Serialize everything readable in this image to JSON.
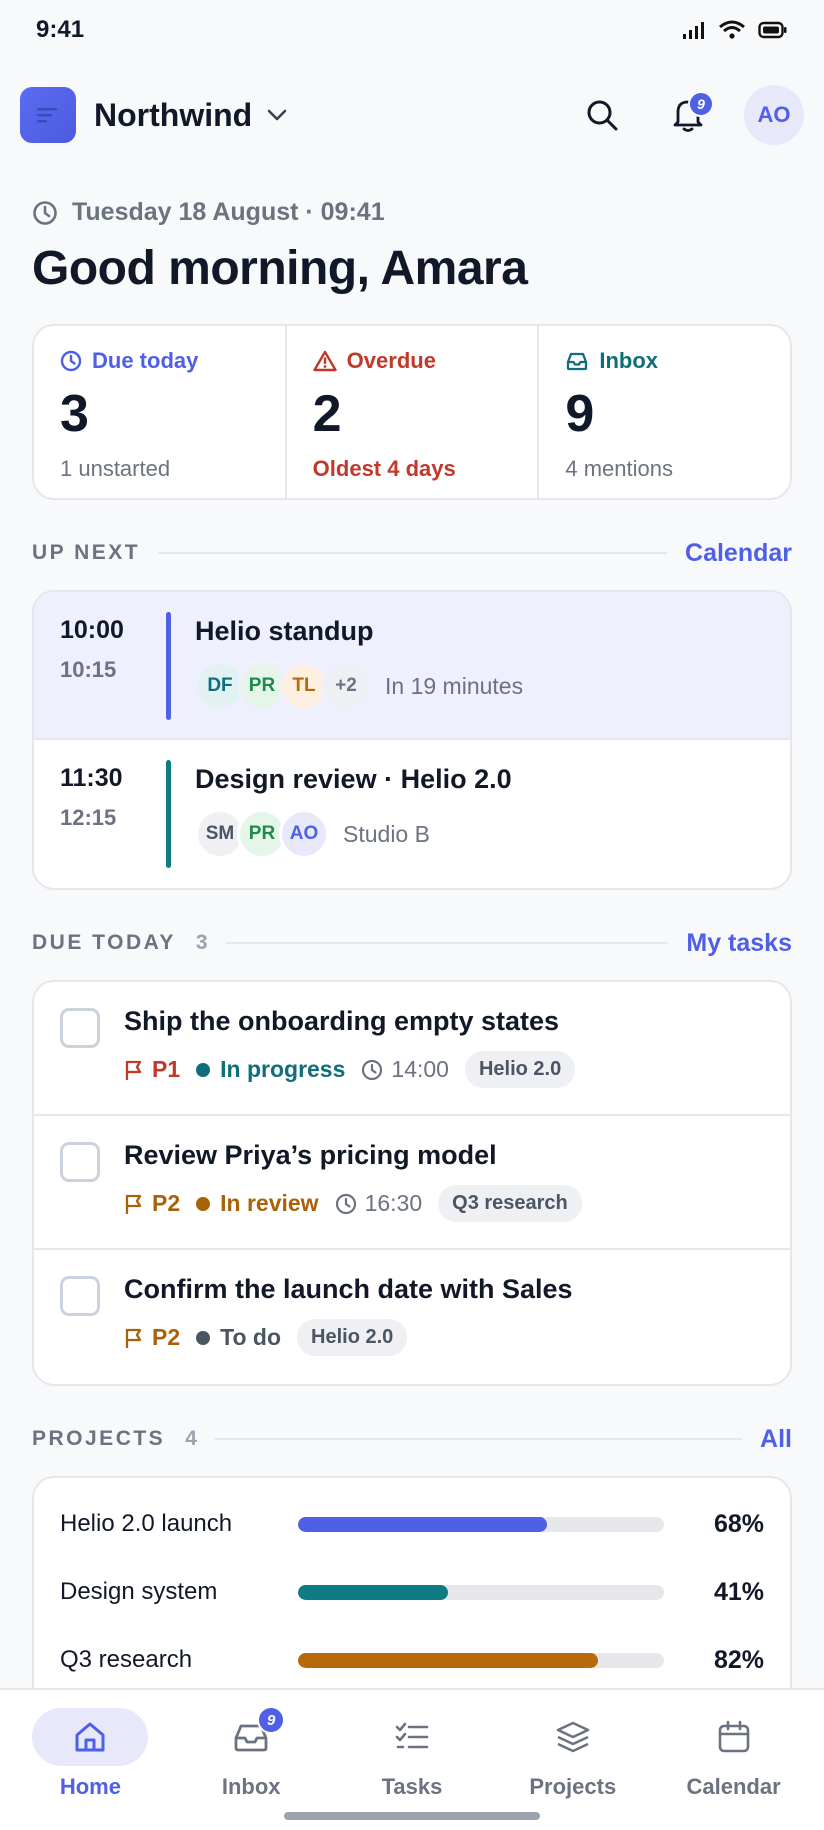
{
  "status_bar": {
    "time": "9:41"
  },
  "header": {
    "workspace": "Northwind",
    "notifications_count": "9",
    "avatar_initials": "AO"
  },
  "greeting": {
    "date": "Tuesday 18 August · 09:41",
    "text": "Good morning, Amara"
  },
  "stats": [
    {
      "label": "Due today",
      "value": "3",
      "sub": "1 unstarted",
      "color": "#4f5fe6"
    },
    {
      "label": "Overdue",
      "value": "2",
      "sub": "Oldest 4 days",
      "color": "#c0392b"
    },
    {
      "label": "Inbox",
      "value": "9",
      "sub": "4 mentions",
      "color": "#0f6e7a"
    }
  ],
  "up_next": {
    "title": "UP NEXT",
    "link": "Calendar",
    "events": [
      {
        "start": "10:00",
        "end": "10:15",
        "title": "Helio standup",
        "attendees": [
          "DF",
          "PR",
          "TL",
          "+2"
        ],
        "note": "In 19 minutes",
        "color": "#4f5fe6"
      },
      {
        "start": "11:30",
        "end": "12:15",
        "title": "Design review · Helio 2.0",
        "attendees": [
          "SM",
          "PR",
          "AO"
        ],
        "note": "Studio B",
        "color": "#0f7b84"
      }
    ]
  },
  "due_today": {
    "title": "DUE TODAY",
    "count": "3",
    "link": "My tasks",
    "tasks": [
      {
        "title": "Ship the onboarding empty states",
        "priority": "P1",
        "status": "In progress",
        "time": "14:00",
        "tag": "Helio 2.0"
      },
      {
        "title": "Review Priya’s pricing model",
        "priority": "P2",
        "status": "In review",
        "time": "16:30",
        "tag": "Q3 research"
      },
      {
        "title": "Confirm the launch date with Sales",
        "priority": "P2",
        "status": "To do",
        "time": "",
        "tag": "Helio 2.0"
      }
    ]
  },
  "projects": {
    "title": "PROJECTS",
    "count": "4",
    "link": "All",
    "items": [
      {
        "name": "Helio 2.0 launch",
        "progress": 68,
        "pct": "68%",
        "color": "#4f5fe6"
      },
      {
        "name": "Design system",
        "progress": 41,
        "pct": "41%",
        "color": "#0f7b84"
      },
      {
        "name": "Q3 research",
        "progress": 82,
        "pct": "82%",
        "color": "#b8690a"
      }
    ]
  },
  "tabs": [
    {
      "label": "Home",
      "icon": "home-icon"
    },
    {
      "label": "Inbox",
      "icon": "inbox-icon",
      "badge": "9"
    },
    {
      "label": "Tasks",
      "icon": "tasks-icon"
    },
    {
      "label": "Projects",
      "icon": "layers-icon"
    },
    {
      "label": "Calendar",
      "icon": "calendar-icon"
    }
  ]
}
